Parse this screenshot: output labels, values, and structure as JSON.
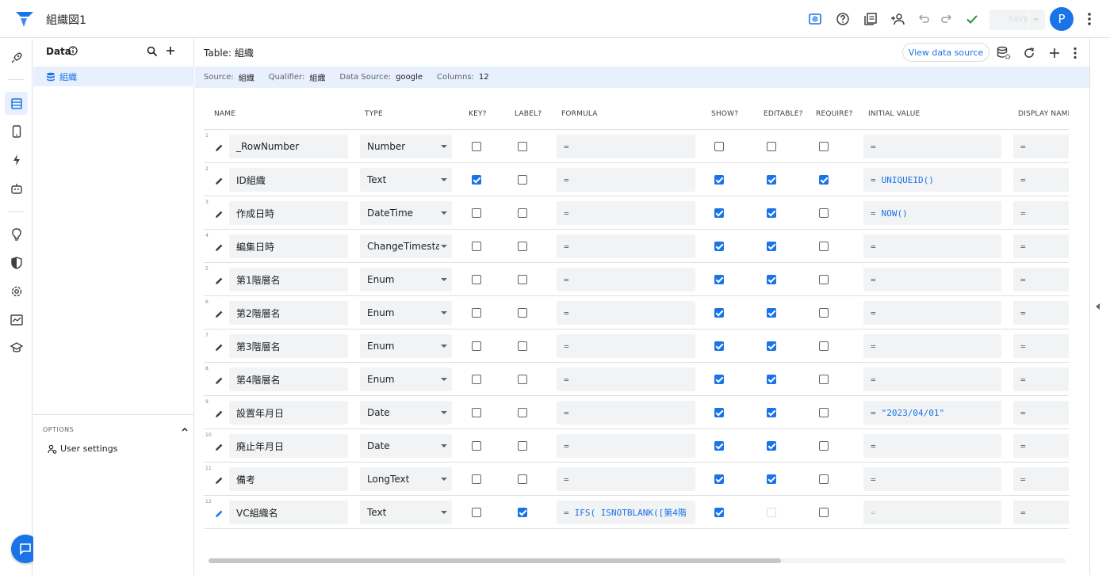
{
  "app": {
    "title": "組織図1",
    "save_label": "SAVE",
    "avatar_letter": "P"
  },
  "sidebar": {
    "heading": "Data",
    "items": [
      {
        "label": "組織"
      }
    ],
    "options_title": "OPTIONS",
    "user_settings_label": "User settings"
  },
  "main": {
    "table_title": "Table: 組織",
    "view_data_source": "View data source",
    "info": {
      "source_key": "Source:",
      "source_val": "組織",
      "qualifier_key": "Qualifier:",
      "qualifier_val": "組織",
      "datasource_key": "Data Source:",
      "datasource_val": "google",
      "columns_key": "Columns:",
      "columns_val": "12"
    }
  },
  "columns": {
    "name": "NAME",
    "type": "TYPE",
    "key": "KEY?",
    "label": "LABEL?",
    "formula": "FORMULA",
    "show": "SHOW?",
    "editable": "EDITABLE?",
    "require": "REQUIRE?",
    "initial_value": "INITIAL VALUE",
    "display_name": "DISPLAY NAME"
  },
  "rows": [
    {
      "num": "1",
      "name": "_RowNumber",
      "type": "Number",
      "key": false,
      "label": false,
      "formula": "",
      "show": false,
      "editable": false,
      "require": false,
      "initial": ""
    },
    {
      "num": "2",
      "name": "ID組織",
      "type": "Text",
      "key": true,
      "label": false,
      "formula": "",
      "show": true,
      "editable": true,
      "require": true,
      "initial": "UNIQUEID()"
    },
    {
      "num": "3",
      "name": "作成日時",
      "type": "DateTime",
      "key": false,
      "label": false,
      "formula": "",
      "show": true,
      "editable": true,
      "require": false,
      "initial": "NOW()"
    },
    {
      "num": "4",
      "name": "編集日時",
      "type": "ChangeTimestamp",
      "key": false,
      "label": false,
      "formula": "",
      "show": true,
      "editable": true,
      "require": false,
      "initial": ""
    },
    {
      "num": "5",
      "name": "第1階層名",
      "type": "Enum",
      "key": false,
      "label": false,
      "formula": "",
      "show": true,
      "editable": true,
      "require": false,
      "initial": ""
    },
    {
      "num": "6",
      "name": "第2階層名",
      "type": "Enum",
      "key": false,
      "label": false,
      "formula": "",
      "show": true,
      "editable": true,
      "require": false,
      "initial": ""
    },
    {
      "num": "7",
      "name": "第3階層名",
      "type": "Enum",
      "key": false,
      "label": false,
      "formula": "",
      "show": true,
      "editable": true,
      "require": false,
      "initial": ""
    },
    {
      "num": "8",
      "name": "第4階層名",
      "type": "Enum",
      "key": false,
      "label": false,
      "formula": "",
      "show": true,
      "editable": true,
      "require": false,
      "initial": ""
    },
    {
      "num": "9",
      "name": "設置年月日",
      "type": "Date",
      "key": false,
      "label": false,
      "formula": "",
      "show": true,
      "editable": true,
      "require": false,
      "initial": "\"2023/04/01\""
    },
    {
      "num": "10",
      "name": "廃止年月日",
      "type": "Date",
      "key": false,
      "label": false,
      "formula": "",
      "show": true,
      "editable": true,
      "require": false,
      "initial": ""
    },
    {
      "num": "11",
      "name": "備考",
      "type": "LongText",
      "key": false,
      "label": false,
      "formula": "",
      "show": true,
      "editable": true,
      "require": false,
      "initial": ""
    },
    {
      "num": "12",
      "name": "VC組織名",
      "type": "Text",
      "key": false,
      "label": true,
      "formula": "IFS(  ISNOTBLANK([第4階",
      "show": true,
      "editable": "disabled",
      "require": false,
      "initial": "",
      "initial_disabled": true
    }
  ],
  "eq_sign": "=",
  "colors": {
    "accent": "#1a73e8",
    "check_green": "#1e8e3e",
    "info_bg": "#e8f0fe"
  },
  "icons": {
    "toolbar": [
      "preview-icon",
      "help-icon",
      "docs-icon",
      "share-icon",
      "undo-icon",
      "redo-icon",
      "check-icon"
    ],
    "rail": [
      "rocket-icon",
      "data-icon",
      "views-icon",
      "bolt-icon",
      "automation-icon",
      "bulb-icon",
      "security-icon",
      "settings-icon",
      "manage-icon",
      "learn-icon"
    ]
  }
}
